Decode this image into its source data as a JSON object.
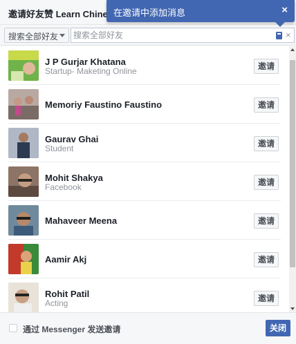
{
  "dialog": {
    "title": "邀请好友赞 Learn Chine",
    "tooltip": {
      "text": "在邀请中添加消息",
      "close_label": "×"
    }
  },
  "toolbar": {
    "filter_label": "搜索全部好友",
    "search_placeholder": "搜索全部好友",
    "search_value": "",
    "clear_label": "×"
  },
  "friends": [
    {
      "name": "J P Gurjar Khatana",
      "subtitle": "Startup- Maketing Online",
      "invite_label": "邀请"
    },
    {
      "name": "Memoriy Faustino Faustino",
      "subtitle": "",
      "invite_label": "邀请"
    },
    {
      "name": "Gaurav Ghai",
      "subtitle": "Student",
      "invite_label": "邀请"
    },
    {
      "name": "Mohit Shakya",
      "subtitle": "Facebook",
      "invite_label": "邀请"
    },
    {
      "name": "Mahaveer Meena",
      "subtitle": "",
      "invite_label": "邀请"
    },
    {
      "name": "Aamir Akj",
      "subtitle": "",
      "invite_label": "邀请"
    },
    {
      "name": "Rohit Patil",
      "subtitle": "Acting",
      "invite_label": "邀请"
    }
  ],
  "footer": {
    "messenger_label": "通过 Messenger 发送邀请",
    "close_label": "关闭"
  },
  "colors": {
    "accent": "#4267b2",
    "header_bg": "#f6f7f9",
    "secondary_text": "#90949c"
  },
  "icons": {
    "tooltip_close": "close-icon",
    "filter_caret": "chevron-down-icon",
    "search_book": "address-book-icon",
    "search_clear": "clear-icon"
  }
}
